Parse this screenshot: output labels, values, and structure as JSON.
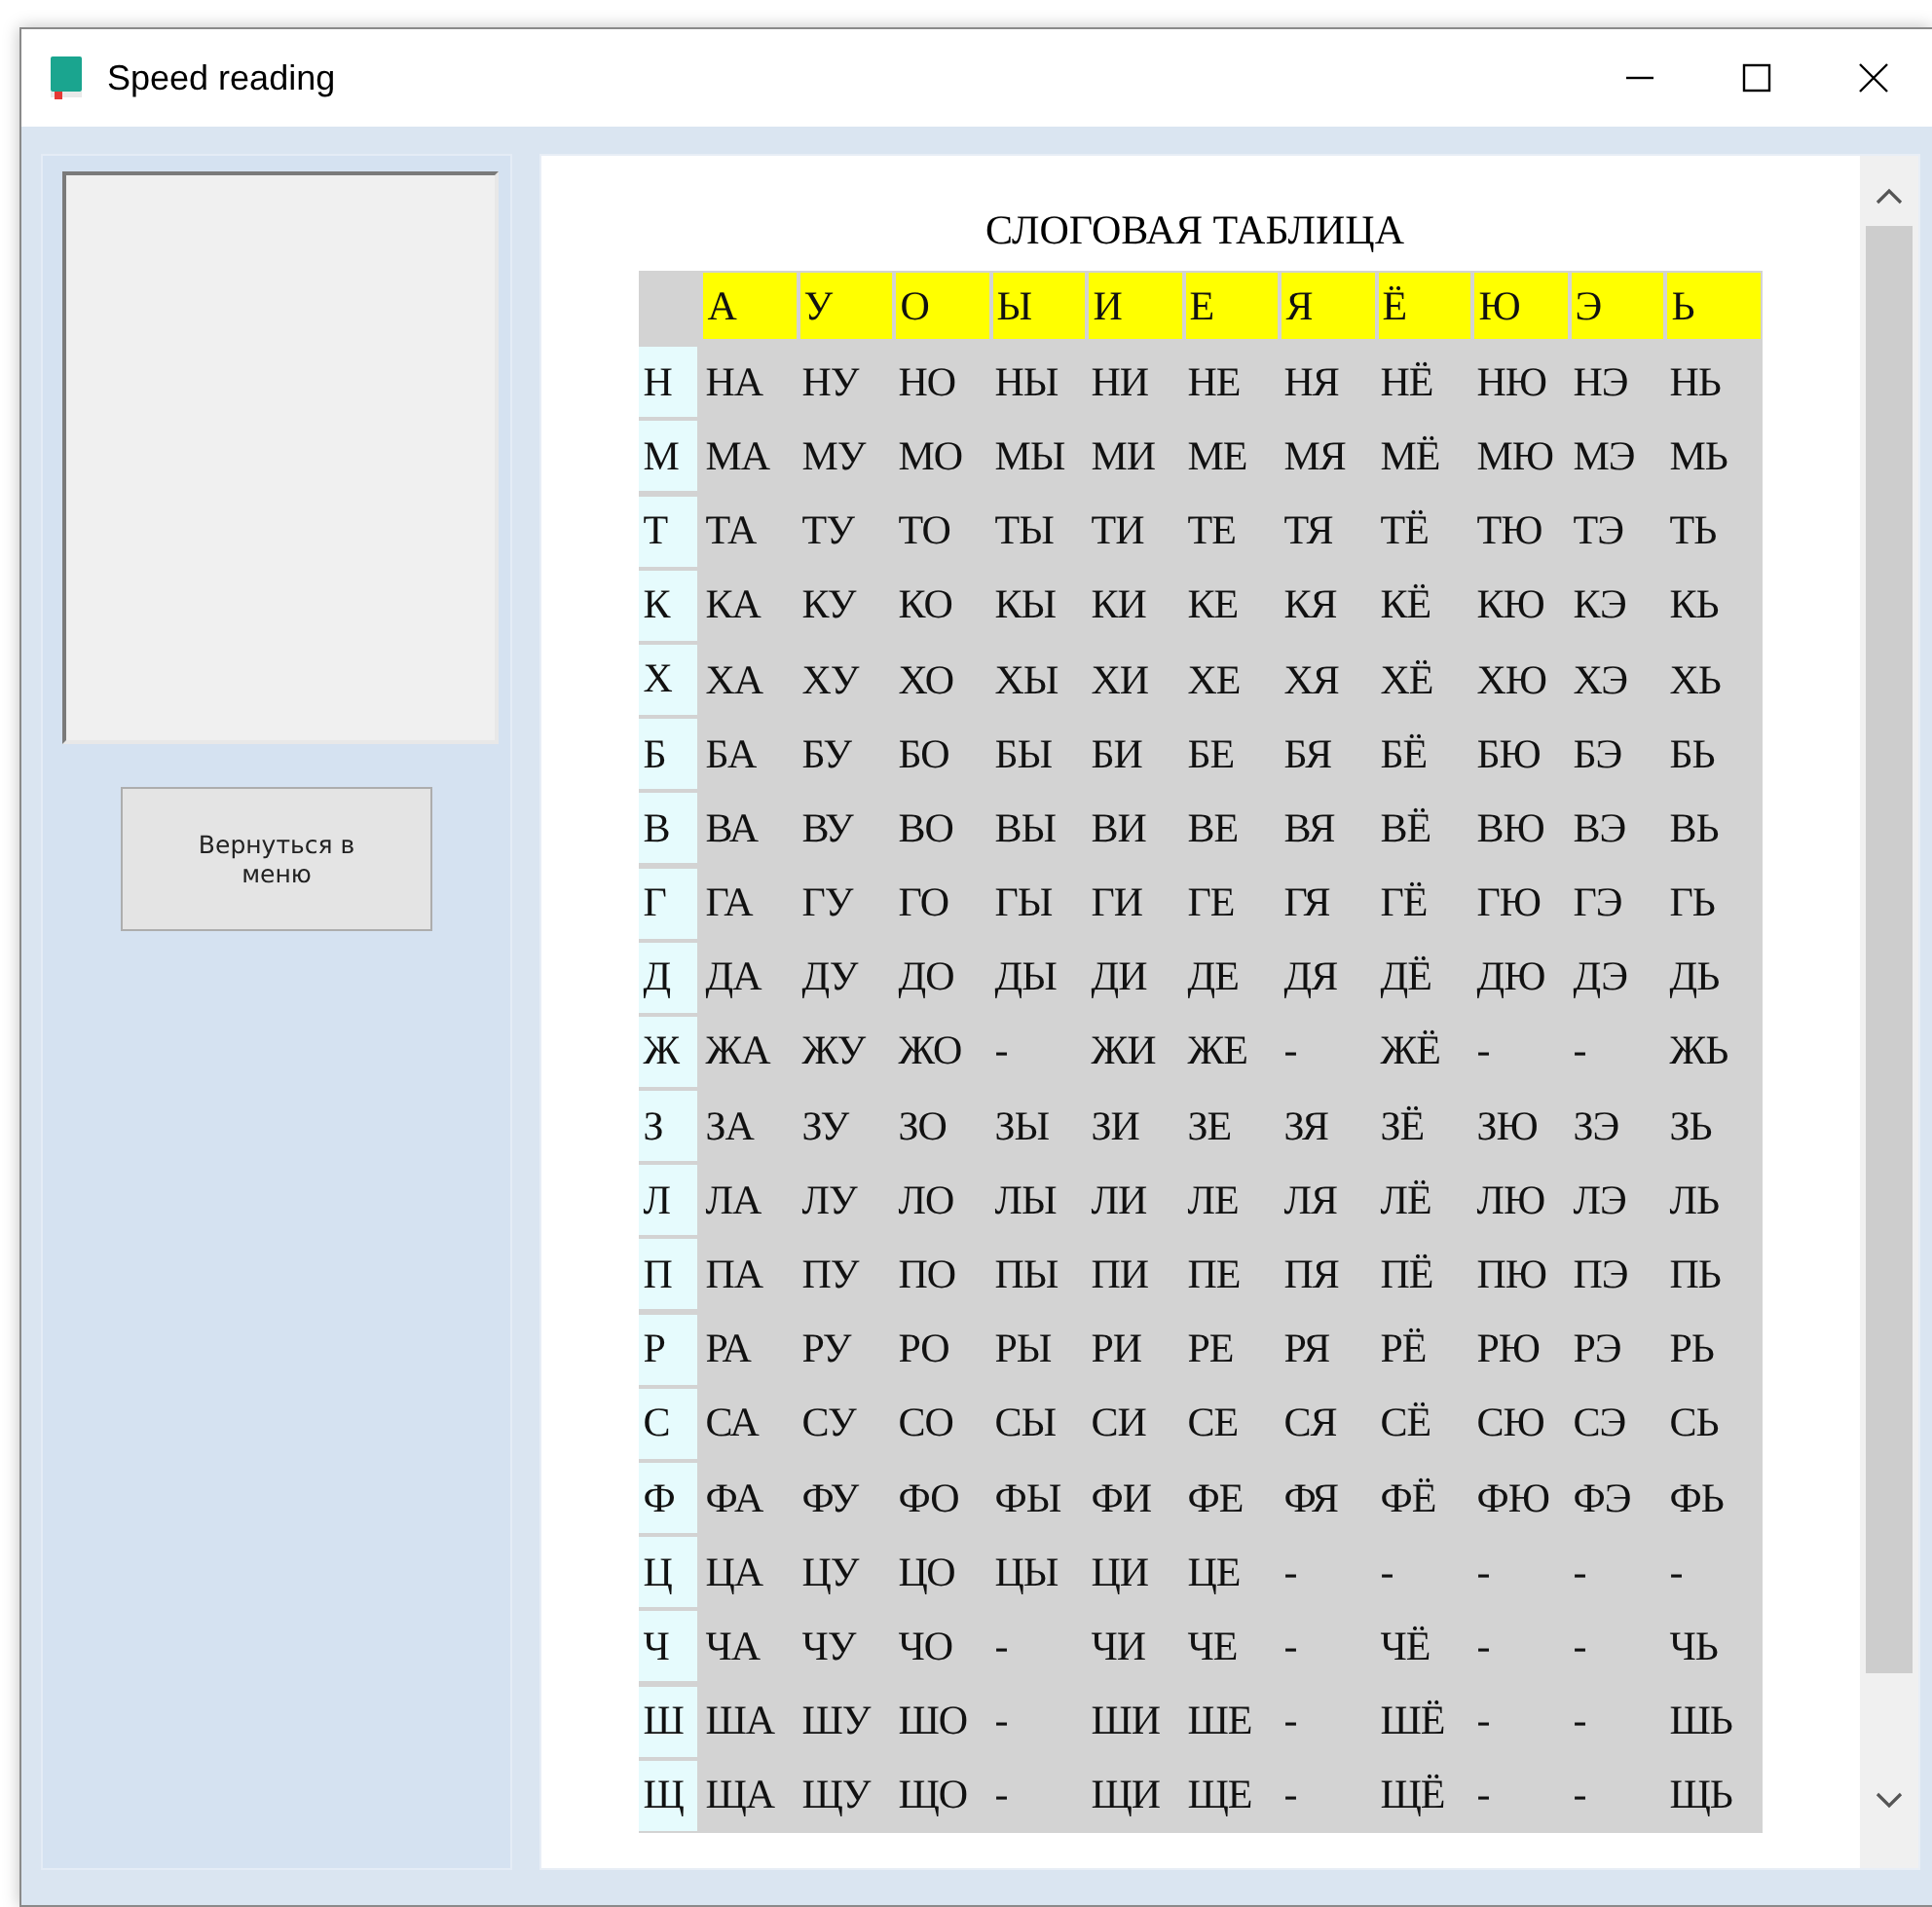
{
  "window": {
    "title": "Speed reading"
  },
  "sidebar": {
    "back_button": "Вернуться в меню"
  },
  "table": {
    "title": "СЛОГОВАЯ ТАБЛИЦА",
    "columns": [
      "А",
      "У",
      "О",
      "Ы",
      "И",
      "Е",
      "Я",
      "Ё",
      "Ю",
      "Э",
      "Ь"
    ],
    "rows": [
      {
        "head": "Н",
        "cells": [
          "НА",
          "НУ",
          "НО",
          "НЫ",
          "НИ",
          "НЕ",
          "НЯ",
          "НЁ",
          "НЮ",
          "НЭ",
          "НЬ"
        ]
      },
      {
        "head": "М",
        "cells": [
          "МА",
          "МУ",
          "МО",
          "МЫ",
          "МИ",
          "МЕ",
          "МЯ",
          "МЁ",
          "МЮ",
          "МЭ",
          "МЬ"
        ]
      },
      {
        "head": "Т",
        "cells": [
          "ТА",
          "ТУ",
          "ТО",
          "ТЫ",
          "ТИ",
          "ТЕ",
          "ТЯ",
          "ТЁ",
          "ТЮ",
          "ТЭ",
          "ТЬ"
        ]
      },
      {
        "head": "К",
        "cells": [
          "КА",
          "КУ",
          "КО",
          "КЫ",
          "КИ",
          "КЕ",
          "КЯ",
          "КЁ",
          "КЮ",
          "КЭ",
          "КЬ"
        ]
      },
      {
        "head": "Х",
        "cells": [
          "ХА",
          "ХУ",
          "ХО",
          "ХЫ",
          "ХИ",
          "ХЕ",
          "ХЯ",
          "ХЁ",
          "ХЮ",
          "ХЭ",
          "ХЬ"
        ]
      },
      {
        "head": "Б",
        "cells": [
          "БА",
          "БУ",
          "БО",
          "БЫ",
          "БИ",
          "БЕ",
          "БЯ",
          "БЁ",
          "БЮ",
          "БЭ",
          "БЬ"
        ]
      },
      {
        "head": "В",
        "cells": [
          "ВА",
          "ВУ",
          "ВО",
          "ВЫ",
          "ВИ",
          "ВЕ",
          "ВЯ",
          "ВЁ",
          "ВЮ",
          "ВЭ",
          "ВЬ"
        ]
      },
      {
        "head": "Г",
        "cells": [
          "ГА",
          "ГУ",
          "ГО",
          "ГЫ",
          "ГИ",
          "ГЕ",
          "ГЯ",
          "ГЁ",
          "ГЮ",
          "ГЭ",
          "ГЬ"
        ]
      },
      {
        "head": "Д",
        "cells": [
          "ДА",
          "ДУ",
          "ДО",
          "ДЫ",
          "ДИ",
          "ДЕ",
          "ДЯ",
          "ДЁ",
          "ДЮ",
          "ДЭ",
          "ДЬ"
        ]
      },
      {
        "head": "Ж",
        "cells": [
          "ЖА",
          "ЖУ",
          "ЖО",
          "-",
          "ЖИ",
          "ЖЕ",
          "-",
          "ЖЁ",
          "-",
          "-",
          "ЖЬ"
        ]
      },
      {
        "head": "З",
        "cells": [
          "ЗА",
          "ЗУ",
          "ЗО",
          "ЗЫ",
          "ЗИ",
          "ЗЕ",
          "ЗЯ",
          "ЗЁ",
          "ЗЮ",
          "ЗЭ",
          "ЗЬ"
        ]
      },
      {
        "head": "Л",
        "cells": [
          "ЛА",
          "ЛУ",
          "ЛО",
          "ЛЫ",
          "ЛИ",
          "ЛЕ",
          "ЛЯ",
          "ЛЁ",
          "ЛЮ",
          "ЛЭ",
          "ЛЬ"
        ]
      },
      {
        "head": "П",
        "cells": [
          "ПА",
          "ПУ",
          "ПО",
          "ПЫ",
          "ПИ",
          "ПЕ",
          "ПЯ",
          "ПЁ",
          "ПЮ",
          "ПЭ",
          "ПЬ"
        ]
      },
      {
        "head": "Р",
        "cells": [
          "РА",
          "РУ",
          "РО",
          "РЫ",
          "РИ",
          "РЕ",
          "РЯ",
          "РЁ",
          "РЮ",
          "РЭ",
          "РЬ"
        ]
      },
      {
        "head": "С",
        "cells": [
          "СА",
          "СУ",
          "СО",
          "СЫ",
          "СИ",
          "СЕ",
          "СЯ",
          "СЁ",
          "СЮ",
          "СЭ",
          "СЬ"
        ]
      },
      {
        "head": "Ф",
        "cells": [
          "ФА",
          "ФУ",
          "ФО",
          "ФЫ",
          "ФИ",
          "ФЕ",
          "ФЯ",
          "ФЁ",
          "ФЮ",
          "ФЭ",
          "ФЬ"
        ]
      },
      {
        "head": "Ц",
        "cells": [
          "ЦА",
          "ЦУ",
          "ЦО",
          "ЦЫ",
          "ЦИ",
          "ЦЕ",
          "-",
          "-",
          "-",
          "-",
          "-"
        ]
      },
      {
        "head": "Ч",
        "cells": [
          "ЧА",
          "ЧУ",
          "ЧО",
          "-",
          "ЧИ",
          "ЧЕ",
          "-",
          "ЧЁ",
          "-",
          "-",
          "ЧЬ"
        ]
      },
      {
        "head": "Ш",
        "cells": [
          "ША",
          "ШУ",
          "ШО",
          "-",
          "ШИ",
          "ШЕ",
          "-",
          "ШЁ",
          "-",
          "-",
          "ШЬ"
        ]
      },
      {
        "head": "Щ",
        "cells": [
          "ЩА",
          "ЩУ",
          "ЩО",
          "-",
          "ЩИ",
          "ЩЕ",
          "-",
          "ЩЁ",
          "-",
          "-",
          "ЩЬ"
        ]
      }
    ]
  }
}
